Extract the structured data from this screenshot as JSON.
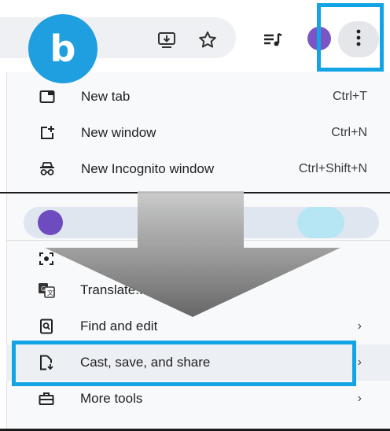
{
  "badge": {
    "letter": "b"
  },
  "colors": {
    "accent_blue": "#13a4e6",
    "badge_blue": "#1f9fe0",
    "profile_purple": "#7b55c6"
  },
  "toolbar": {
    "icons": [
      "install-app-icon",
      "bookmark-star-icon",
      "media-queue-icon",
      "profile-avatar",
      "more-menu-icon"
    ]
  },
  "menu": {
    "items": [
      {
        "label": "New tab",
        "shortcut": "Ctrl+T",
        "icon": "new-tab-icon"
      },
      {
        "label": "New window",
        "shortcut": "Ctrl+N",
        "icon": "new-window-icon"
      },
      {
        "label": "New Incognito window",
        "shortcut": "Ctrl+Shift+N",
        "icon": "incognito-icon"
      },
      {
        "label": "Translate...",
        "icon": "translate-icon"
      },
      {
        "label": "Find and edit",
        "icon": "find-icon"
      },
      {
        "label": "Cast, save, and share",
        "icon": "cast-save-share-icon"
      },
      {
        "label": "More tools",
        "icon": "toolbox-icon"
      }
    ]
  }
}
